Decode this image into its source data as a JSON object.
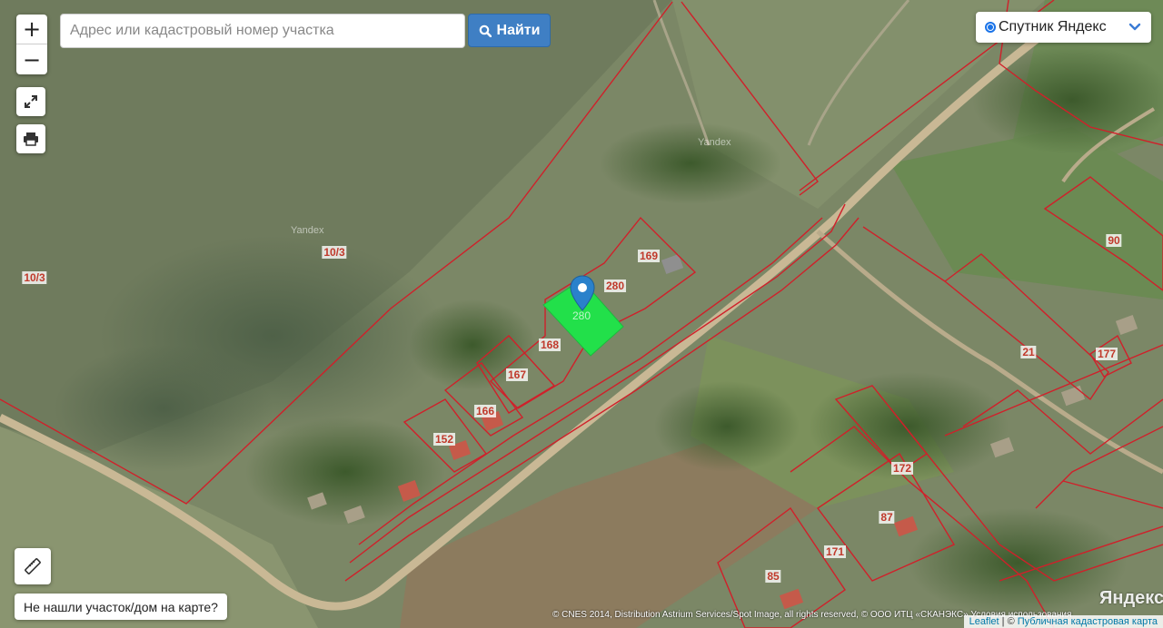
{
  "search": {
    "placeholder": "Адрес или кадастровый номер участка",
    "button_label": "Найти"
  },
  "controls": {
    "zoom_in": "+",
    "zoom_out": "−"
  },
  "layer": {
    "selected": "Спутник Яндекс"
  },
  "not_found_label": "Не нашли участок/дом на карте?",
  "parcels": [
    {
      "id": "p1",
      "label": "10/3"
    },
    {
      "id": "p2",
      "label": "10/3"
    },
    {
      "id": "p3",
      "label": "169"
    },
    {
      "id": "p4",
      "label": "280"
    },
    {
      "id": "p5",
      "label": "168"
    },
    {
      "id": "p6",
      "label": "167"
    },
    {
      "id": "p7",
      "label": "166"
    },
    {
      "id": "p8",
      "label": "152"
    },
    {
      "id": "p9",
      "label": "90"
    },
    {
      "id": "p10",
      "label": "21"
    },
    {
      "id": "p11",
      "label": "177"
    },
    {
      "id": "p12",
      "label": "172"
    },
    {
      "id": "p13",
      "label": "87"
    },
    {
      "id": "p14",
      "label": "171"
    },
    {
      "id": "p15",
      "label": "85"
    }
  ],
  "selected_parcel_label": "280",
  "watermarks": [
    "Yandex",
    "Yandex"
  ],
  "attribution_text": "© CNES 2014, Distribution Astrium Services/Spot Image, all rights reserved, © ООО ИТЦ «СКАНЭКС» Условия использования",
  "yandex_logo": "Яндекс",
  "leaflet": {
    "leaflet_label": "Leaflet",
    "separator": " | © ",
    "source_label": "Публичная кадастровая карта"
  },
  "colors": {
    "parcel_border": "#d0202a",
    "selected_fill": "#22e04a",
    "find_button": "#3f7fc4",
    "pin": "#2a81cb"
  },
  "icons": {
    "search_button": "search-icon",
    "fullscreen": "expand-icon",
    "print": "printer-icon",
    "ruler": "ruler-icon",
    "layer_dropdown": "chevron-down-icon",
    "marker": "map-pin-icon"
  }
}
